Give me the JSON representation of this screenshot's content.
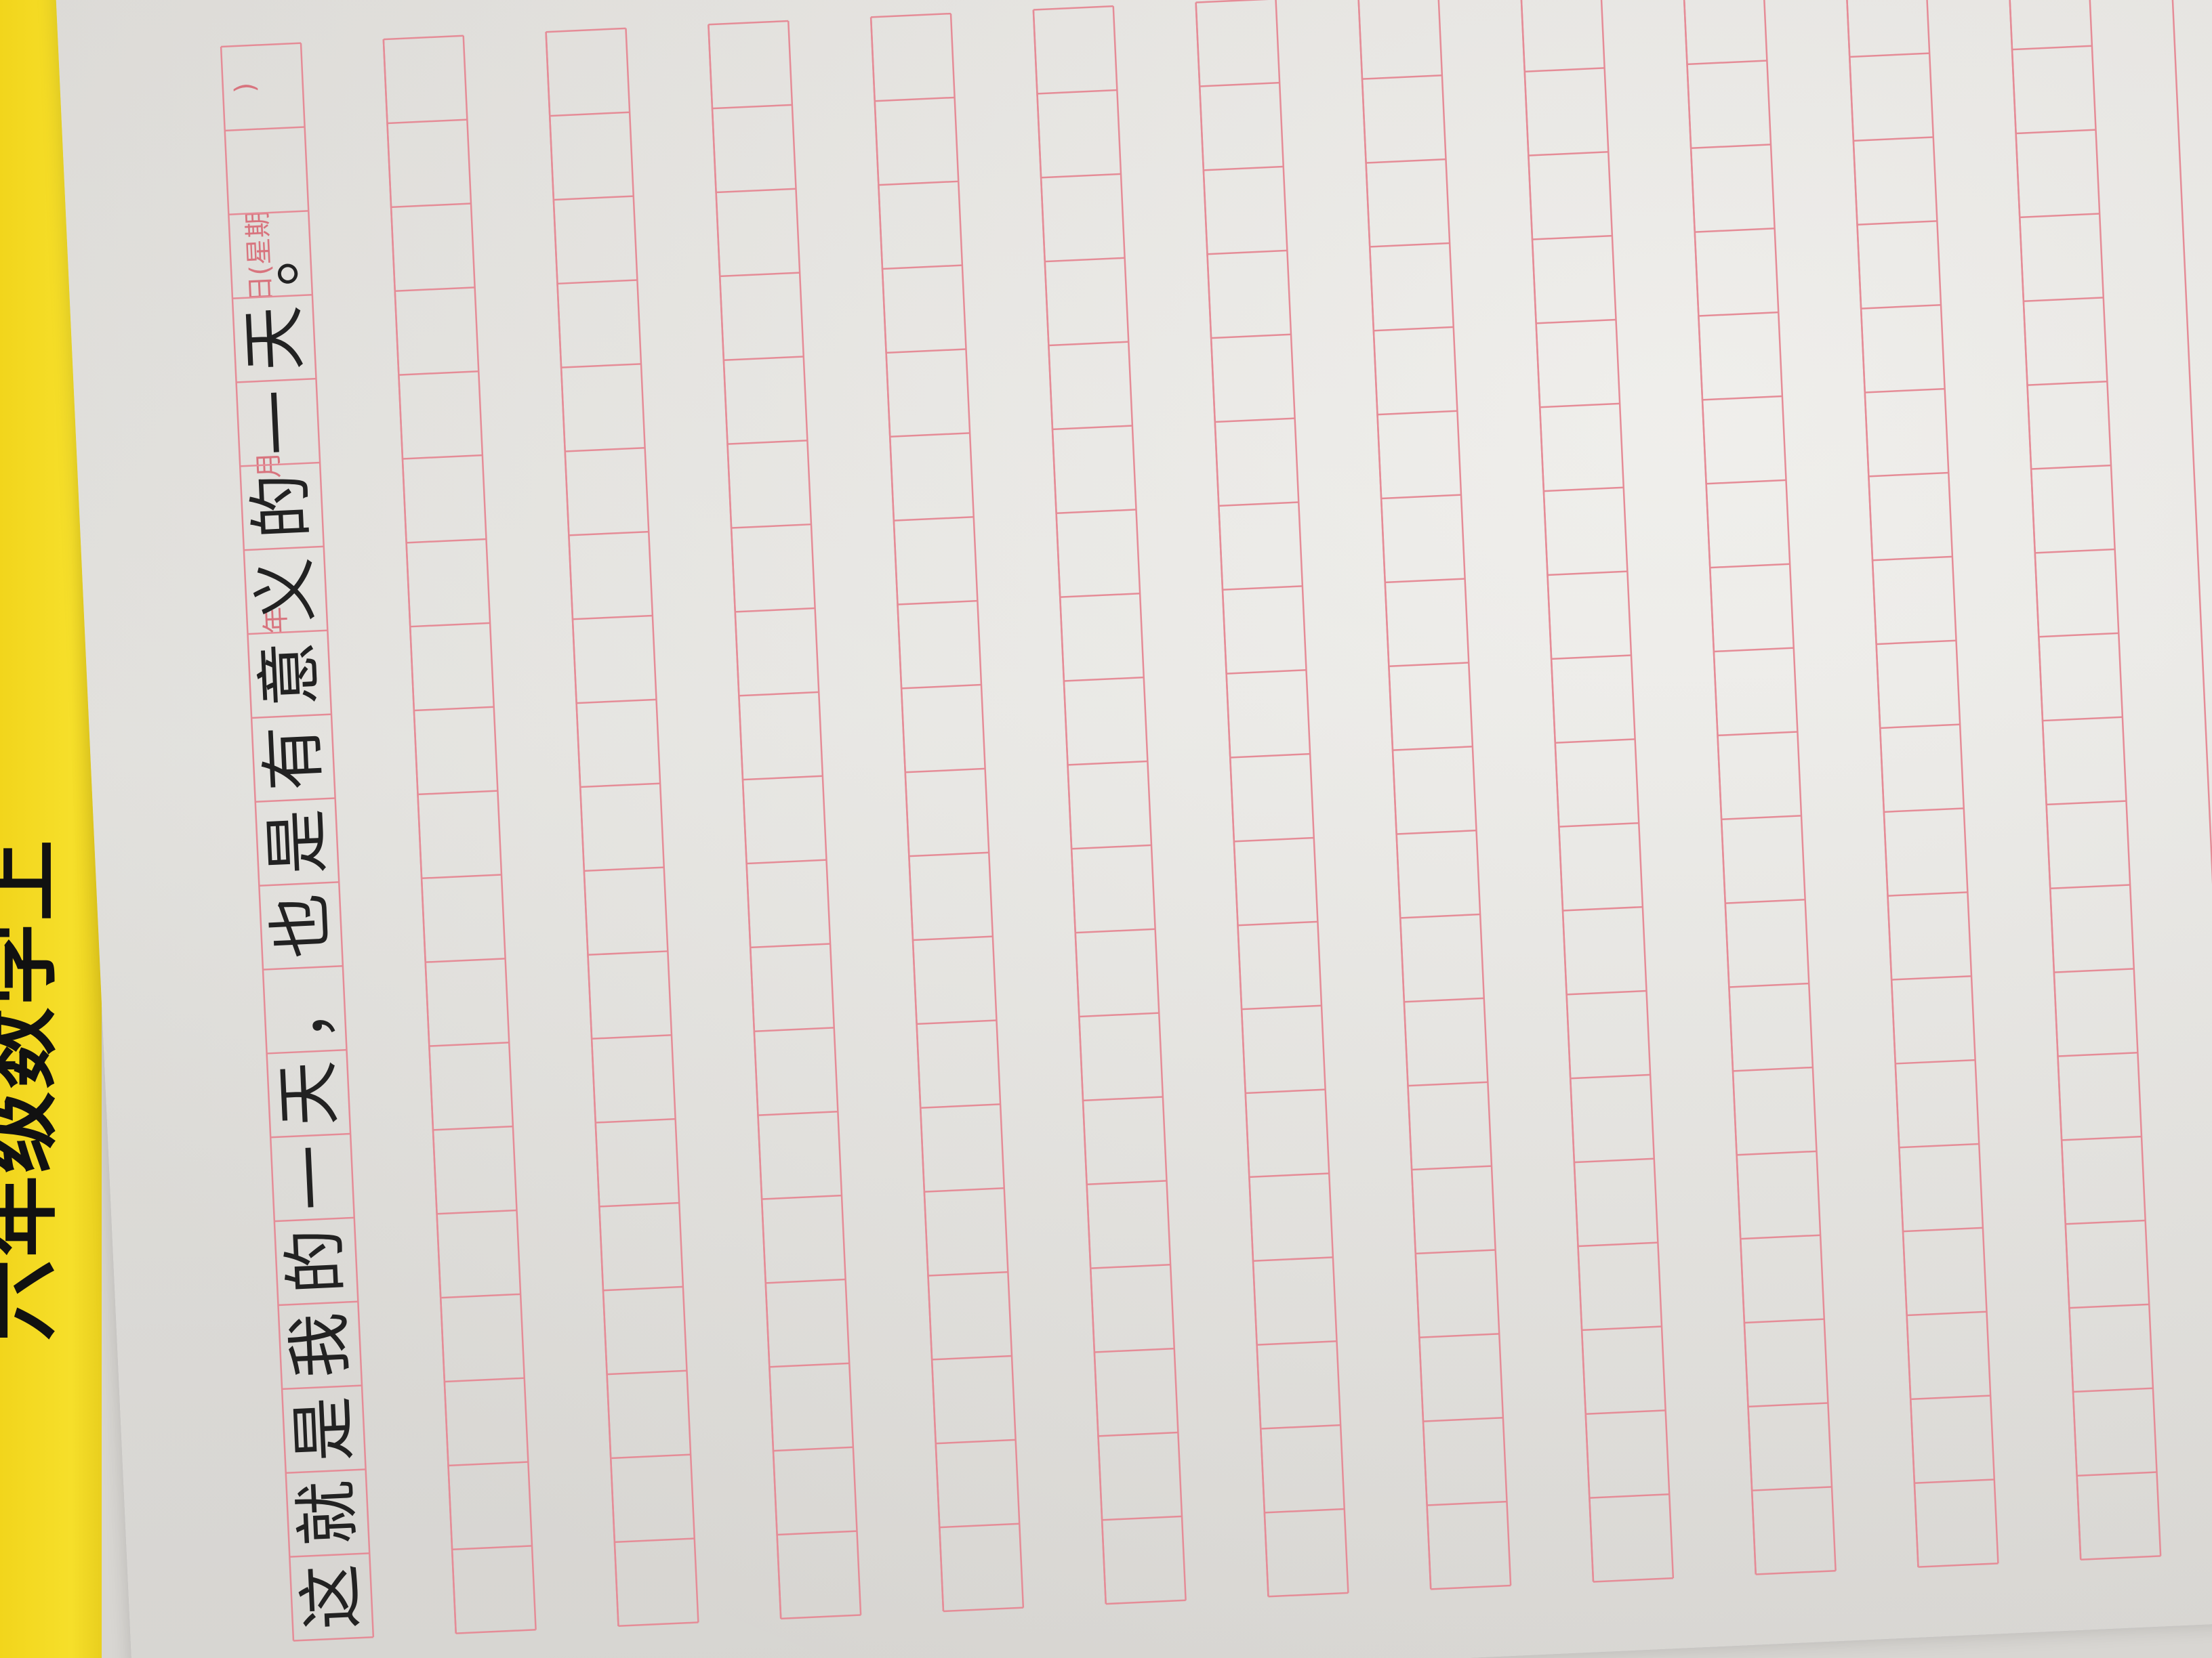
{
  "cover": {
    "title": "六年级数学上"
  },
  "header": {
    "year_label": "年",
    "month_label": "月",
    "day_label": "日(星期",
    "close_paren": ")"
  },
  "handwriting": {
    "line1": [
      "这",
      "就",
      "是",
      "我",
      "的",
      "一",
      "天",
      "，"
    ],
    "line2": [
      "也",
      "是",
      "有",
      "意",
      "义",
      "的",
      "一",
      "天",
      "。"
    ]
  },
  "colors": {
    "grid_line": "#e58c97",
    "paper": "#e9e7e3",
    "cover": "#f4da22",
    "ink": "#222222"
  }
}
